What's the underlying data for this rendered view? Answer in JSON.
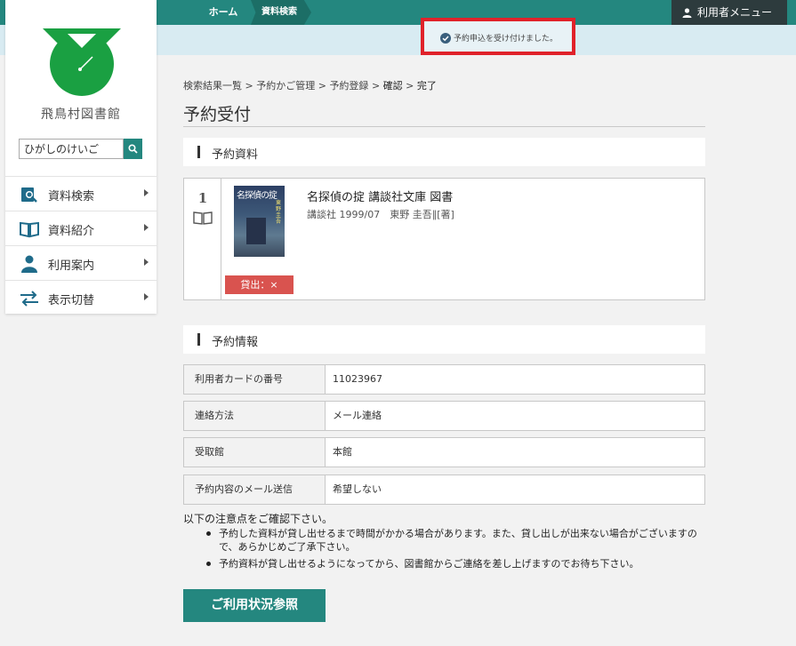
{
  "header": {
    "breadcrumb_home": "ホーム",
    "breadcrumb_search": "資料検索",
    "user_menu": "利用者メニュー"
  },
  "notice": {
    "message": "予約申込を受け付けました。",
    "icon": "check-circle-icon",
    "highlight_color": "#e0222a"
  },
  "sidebar": {
    "library_name": "飛鳥村図書館",
    "search_value": "ひがしのけいご",
    "items": [
      {
        "label": "資料検索",
        "icon": "search-book-icon"
      },
      {
        "label": "資料紹介",
        "icon": "open-book-icon"
      },
      {
        "label": "利用案内",
        "icon": "user-icon"
      },
      {
        "label": "表示切替",
        "icon": "switch-arrows-icon"
      }
    ]
  },
  "main": {
    "breadcrumb": {
      "items": [
        "検索結果一覧",
        "予約かご管理",
        "予約登録",
        "確認",
        "完了"
      ],
      "separator": ">"
    },
    "page_title": "予約受付",
    "reservation_section": "予約資料",
    "book": {
      "number": "1",
      "cover_title": "名探偵の掟",
      "cover_author": "東野圭吾",
      "title": "名探偵の掟 講談社文庫 図書",
      "meta": "講談社 1999/07　東野 圭吾∥[著]",
      "loan_status": "貸出：×"
    },
    "info_section": "予約情報",
    "info_rows": [
      {
        "label": "利用者カードの番号",
        "value": "11023967"
      },
      {
        "label": "連絡方法",
        "value": "メール連絡"
      },
      {
        "label": "受取館",
        "value": "本館"
      },
      {
        "label": "予約内容のメール送信",
        "value": "希望しない"
      }
    ],
    "notes_intro": "以下の注意点をご確認下さい。",
    "notes": [
      "予約した資料が貸し出せるまで時間がかかる場合があります。また、貸し出しが出来ない場合がございますので、あらかじめご了承下さい。",
      "予約資料が貸し出せるようになってから、図書館からご連絡を差し上げますのでお待ち下さい。"
    ],
    "status_button": "ご利用状況参照"
  },
  "colors": {
    "accent": "#24877f",
    "loan_badge": "#d9534f",
    "logo_green": "#1aa042"
  }
}
